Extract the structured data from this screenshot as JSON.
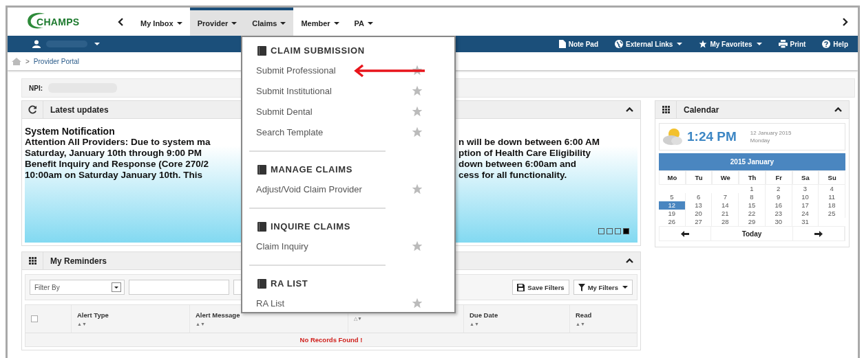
{
  "nav": {
    "logo": "CHAMPS",
    "tabs": [
      {
        "label": "My Inbox",
        "selected": false
      },
      {
        "label": "Provider",
        "selected": true
      },
      {
        "label": "Claims",
        "selected": true
      },
      {
        "label": "Member",
        "selected": false
      },
      {
        "label": "PA",
        "selected": false
      }
    ]
  },
  "toolbar": {
    "links": [
      {
        "kind": "notepad",
        "label": "Note Pad",
        "dropdown": false
      },
      {
        "kind": "globe",
        "label": "External Links",
        "dropdown": true
      },
      {
        "kind": "star",
        "label": "My Favorites",
        "dropdown": true
      },
      {
        "kind": "print",
        "label": "Print",
        "dropdown": false
      },
      {
        "kind": "help",
        "label": "Help",
        "dropdown": false
      }
    ]
  },
  "breadcrumb": {
    "separator": ">",
    "current": "Provider Portal"
  },
  "npi": {
    "label": "NPI:"
  },
  "updates": {
    "title": "Latest updates",
    "heading": "System Notification",
    "lines": [
      {
        "left": "Attention All Providers: Due to system ma",
        "right": "n will be down between 6:00 AM"
      },
      {
        "left": "Saturday, January 10th through 9:00 PM",
        "right": "ption of Health Care Eligibility"
      },
      {
        "left": "Benefit Inquiry and Response (Core 270/2",
        "right": "down between 6:00am and"
      },
      {
        "left": "10:00am on Saturday January 10th. This",
        "right": "cess for all functionality."
      }
    ],
    "slides": [
      {
        "selected": false
      },
      {
        "selected": false
      },
      {
        "selected": false
      },
      {
        "selected": true
      }
    ]
  },
  "reminders": {
    "title": "My Reminders",
    "filter": {
      "value": "Filter By"
    },
    "buttons": [
      {
        "kind": "save",
        "label": "Save Filters",
        "dropdown": false
      },
      {
        "kind": "filter",
        "label": "My Filters",
        "dropdown": true
      }
    ],
    "columns": [
      {
        "kind": "checkbox",
        "checked": false
      },
      {
        "kind": "text",
        "label": "Alert Type",
        "sort": "▲▼"
      },
      {
        "kind": "text",
        "label": "Alert Message",
        "sort": "▲▼"
      },
      {
        "kind": "text",
        "sort": "△▼"
      },
      {
        "kind": "text",
        "label": "Due Date",
        "sort": "▲▼"
      },
      {
        "kind": "text",
        "label": "Read",
        "sort": "▲▼"
      }
    ],
    "empty_message": "No Records Found !"
  },
  "calendar": {
    "title": "Calendar",
    "time": "1:24 PM",
    "date": "12 January 2015",
    "weekday": "Monday",
    "month": "2015 January",
    "weekdays": [
      "Mo",
      "Tu",
      "We",
      "Th",
      "Fr",
      "Sa",
      "Su"
    ],
    "weeks": [
      [
        {
          "day": "1",
          "selected": false
        },
        {
          "day": "2",
          "selected": false
        },
        {
          "day": "3",
          "selected": false
        },
        {
          "day": "4",
          "selected": false
        }
      ],
      [
        {
          "day": "5",
          "selected": false
        },
        {
          "day": "6",
          "selected": false
        },
        {
          "day": "7",
          "selected": false
        },
        {
          "day": "8",
          "selected": false
        },
        {
          "day": "9",
          "selected": false
        },
        {
          "day": "10",
          "selected": false
        },
        {
          "day": "11",
          "selected": false
        }
      ],
      [
        {
          "day": "12",
          "selected": true
        },
        {
          "day": "13",
          "selected": false
        },
        {
          "day": "14",
          "selected": false
        },
        {
          "day": "15",
          "selected": false
        },
        {
          "day": "16",
          "selected": false
        },
        {
          "day": "17",
          "selected": false
        },
        {
          "day": "18",
          "selected": false
        }
      ],
      [
        {
          "day": "19",
          "selected": false
        },
        {
          "day": "20",
          "selected": false
        },
        {
          "day": "21",
          "selected": false
        },
        {
          "day": "22",
          "selected": false
        },
        {
          "day": "23",
          "selected": false
        },
        {
          "day": "24",
          "selected": false
        },
        {
          "day": "25",
          "selected": false
        }
      ],
      [
        {
          "day": "26",
          "selected": false
        },
        {
          "day": "27",
          "selected": false
        },
        {
          "day": "28",
          "selected": false
        },
        {
          "day": "29",
          "selected": false
        },
        {
          "day": "30",
          "selected": false
        },
        {
          "day": "31",
          "selected": false
        }
      ]
    ],
    "today": "Today"
  },
  "menu": {
    "sections": [
      {
        "title": "CLAIM SUBMISSION",
        "items": [
          {
            "label": "Submit Professional",
            "favorite": false
          },
          {
            "label": "Submit Institutional",
            "favorite": false
          },
          {
            "label": "Submit Dental",
            "favorite": false
          },
          {
            "label": "Search Template",
            "favorite": false
          }
        ]
      },
      {
        "title": "MANAGE CLAIMS",
        "items": [
          {
            "label": "Adjust/Void Claim Provider",
            "favorite": false
          }
        ]
      },
      {
        "title": "INQUIRE CLAIMS",
        "items": [
          {
            "label": "Claim Inquiry",
            "favorite": false
          }
        ]
      },
      {
        "title": "RA LIST",
        "items": [
          {
            "label": "RA List",
            "favorite": false
          }
        ]
      }
    ]
  },
  "annotation": {
    "kind": "arrow"
  }
}
